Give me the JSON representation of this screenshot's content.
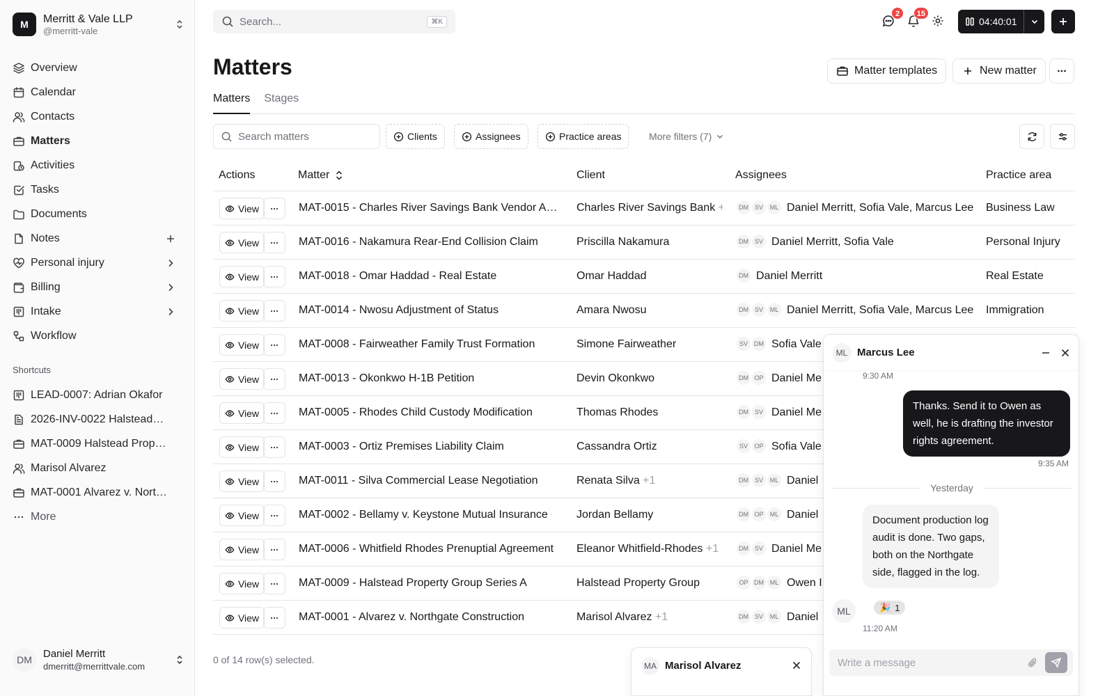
{
  "org": {
    "initial": "M",
    "name": "Merritt & Vale LLP",
    "handle": "@merritt-vale"
  },
  "nav": [
    {
      "label": "Overview",
      "icon": "layers-icon"
    },
    {
      "label": "Calendar",
      "icon": "calendar-icon"
    },
    {
      "label": "Contacts",
      "icon": "users-icon"
    },
    {
      "label": "Matters",
      "icon": "briefcase-icon",
      "active": true
    },
    {
      "label": "Activities",
      "icon": "activity-icon"
    },
    {
      "label": "Tasks",
      "icon": "check-square-icon"
    },
    {
      "label": "Documents",
      "icon": "folder-icon"
    },
    {
      "label": "Notes",
      "icon": "file-icon"
    },
    {
      "label": "Personal injury",
      "icon": "heart-icon"
    },
    {
      "label": "Billing",
      "icon": "wallet-icon"
    },
    {
      "label": "Intake",
      "icon": "columns-icon"
    },
    {
      "label": "Workflow",
      "icon": "workflow-icon"
    }
  ],
  "shortcuts_title": "Shortcuts",
  "shortcuts": [
    {
      "label": "LEAD-0007: Adrian Okafor",
      "icon": "columns-icon"
    },
    {
      "label": "2026-INV-0022 Halstead…",
      "icon": "invoice-icon"
    },
    {
      "label": "MAT-0009 Halstead Prop…",
      "icon": "briefcase-icon"
    },
    {
      "label": "Marisol Alvarez",
      "icon": "users-icon"
    },
    {
      "label": "MAT-0001 Alvarez v. Nort…",
      "icon": "briefcase-icon"
    }
  ],
  "more_label": "More",
  "user": {
    "initials": "DM",
    "name": "Daniel Merritt",
    "email": "dmerritt@merrittvale.com"
  },
  "top": {
    "search_placeholder": "Search...",
    "search_kbd": "⌘K",
    "messages_badge": "2",
    "notifications_badge": "15",
    "timer": "04:40:01"
  },
  "page": {
    "title": "Matters",
    "templates_label": "Matter templates",
    "new_label": "New matter",
    "tabs": [
      "Matters",
      "Stages"
    ],
    "search_placeholder": "Search matters",
    "filters": [
      "Clients",
      "Assignees",
      "Practice areas"
    ],
    "more_filters": "More filters (7)"
  },
  "table": {
    "headers": [
      "Actions",
      "Matter",
      "Client",
      "Assignees",
      "Practice area"
    ],
    "view_label": "View",
    "rows": [
      {
        "matter": "MAT-0015 - Charles River Savings Bank Vendor Agr…",
        "client": "Charles River Savings Bank",
        "client_extra": "+1",
        "avatars": [
          "DM",
          "SV",
          "ML"
        ],
        "assignees": "Daniel Merritt, Sofia Vale, Marcus Lee",
        "practice": "Business Law"
      },
      {
        "matter": "MAT-0016 - Nakamura Rear-End Collision Claim",
        "client": "Priscilla Nakamura",
        "client_extra": "",
        "avatars": [
          "DM",
          "SV"
        ],
        "assignees": "Daniel Merritt, Sofia Vale",
        "practice": "Personal Injury"
      },
      {
        "matter": "MAT-0018 - Omar Haddad - Real Estate",
        "client": "Omar Haddad",
        "client_extra": "",
        "avatars": [
          "DM"
        ],
        "assignees": "Daniel Merritt",
        "practice": "Real Estate"
      },
      {
        "matter": "MAT-0014 - Nwosu Adjustment of Status",
        "client": "Amara Nwosu",
        "client_extra": "",
        "avatars": [
          "DM",
          "SV",
          "ML"
        ],
        "assignees": "Daniel Merritt, Sofia Vale, Marcus Lee",
        "practice": "Immigration"
      },
      {
        "matter": "MAT-0008 - Fairweather Family Trust Formation",
        "client": "Simone Fairweather",
        "client_extra": "",
        "avatars": [
          "SV",
          "DM"
        ],
        "assignees": "Sofia Vale",
        "practice": ""
      },
      {
        "matter": "MAT-0013 - Okonkwo H-1B Petition",
        "client": "Devin Okonkwo",
        "client_extra": "",
        "avatars": [
          "DM",
          "OP"
        ],
        "assignees": "Daniel Me",
        "practice": ""
      },
      {
        "matter": "MAT-0005 - Rhodes Child Custody Modification",
        "client": "Thomas Rhodes",
        "client_extra": "",
        "avatars": [
          "DM",
          "SV"
        ],
        "assignees": "Daniel Me",
        "practice": ""
      },
      {
        "matter": "MAT-0003 - Ortiz Premises Liability Claim",
        "client": "Cassandra Ortiz",
        "client_extra": "",
        "avatars": [
          "SV",
          "OP"
        ],
        "assignees": "Sofia Vale",
        "practice": ""
      },
      {
        "matter": "MAT-0011 - Silva Commercial Lease Negotiation",
        "client": "Renata Silva",
        "client_extra": "+1",
        "avatars": [
          "DM",
          "SV",
          "ML"
        ],
        "assignees": "Daniel",
        "practice": ""
      },
      {
        "matter": "MAT-0002 - Bellamy v. Keystone Mutual Insurance",
        "client": "Jordan Bellamy",
        "client_extra": "",
        "avatars": [
          "DM",
          "OP",
          "ML"
        ],
        "assignees": "Daniel",
        "practice": ""
      },
      {
        "matter": "MAT-0006 - Whitfield Rhodes Prenuptial Agreement",
        "client": "Eleanor Whitfield-Rhodes",
        "client_extra": "+1",
        "avatars": [
          "DM",
          "SV"
        ],
        "assignees": "Daniel Me",
        "practice": ""
      },
      {
        "matter": "MAT-0009 - Halstead Property Group Series A",
        "client": "Halstead Property Group",
        "client_extra": "",
        "avatars": [
          "OP",
          "DM",
          "ML"
        ],
        "assignees": "Owen I",
        "practice": ""
      },
      {
        "matter": "MAT-0001 - Alvarez v. Northgate Construction",
        "client": "Marisol Alvarez",
        "client_extra": "+1",
        "avatars": [
          "DM",
          "SV",
          "ML"
        ],
        "assignees": "Daniel",
        "practice": ""
      }
    ],
    "selection": "0 of 14 row(s) selected."
  },
  "chat": {
    "initials": "ML",
    "name": "Marcus Lee",
    "time_top": "9:30 AM",
    "outgoing": "Thanks. Send it to Owen as well, he is drafting the investor rights agreement.",
    "outgoing_time": "9:35 AM",
    "divider": "Yesterday",
    "incoming": "Document production log audit is done. Two gaps, both on the Northgate side, flagged in the log.",
    "reaction": "🎉",
    "reaction_count": "1",
    "incoming_time": "11:20 AM",
    "input_placeholder": "Write a message"
  },
  "mini_chat": {
    "initials": "MA",
    "name": "Marisol Alvarez"
  }
}
